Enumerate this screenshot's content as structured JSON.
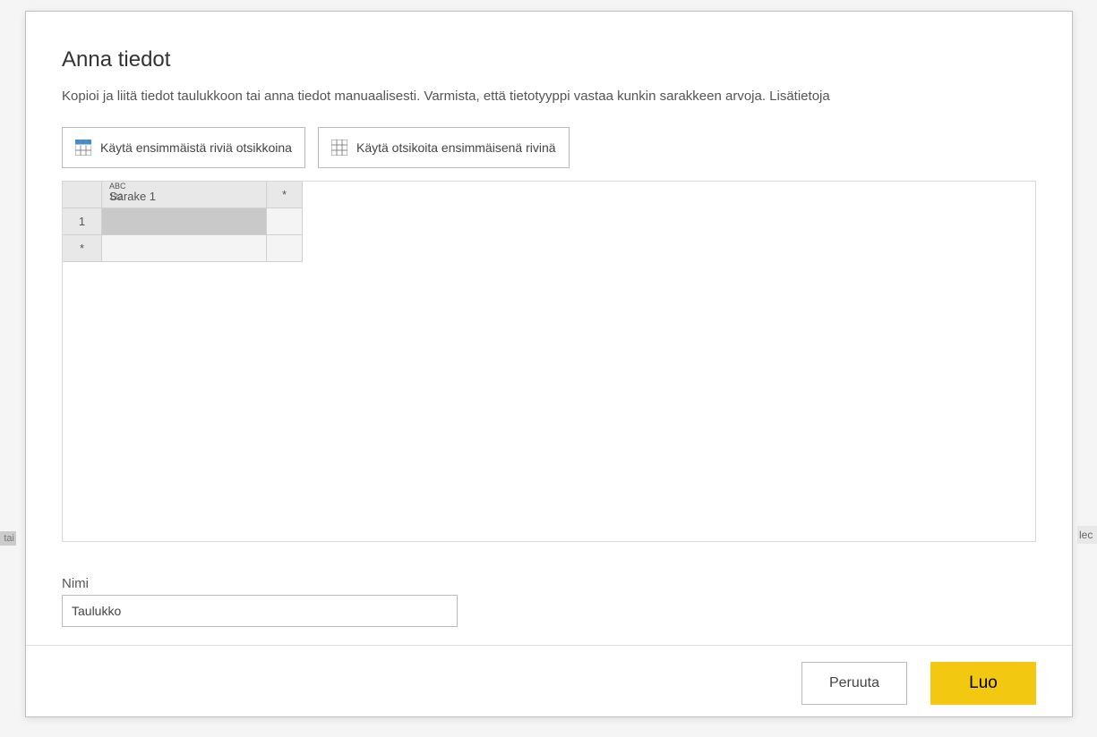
{
  "dialog": {
    "title": "Anna tiedot",
    "description": "Kopioi ja liitä tiedot taulukkoon tai anna tiedot manuaalisesti. Varmista, että tietotyyppi vastaa kunkin sarakkeen arvoja. Lisätietoja"
  },
  "toolbar": {
    "use_first_row_as_headers": "Käytä ensimmäistä riviä otsikkoina",
    "use_headers_as_first_row": "Käytä otsikoita ensimmäisenä rivinä"
  },
  "grid": {
    "type_label": "ABC\n123",
    "column1_name": "Sarake 1",
    "star": "*",
    "row1_label": "1",
    "new_row_label": "*"
  },
  "name_field": {
    "label": "Nimi",
    "value": "Taulukko"
  },
  "footer": {
    "cancel": "Peruuta",
    "create": "Luo"
  },
  "bg": {
    "left_fragment": "tai",
    "right_fragment": "lec"
  }
}
